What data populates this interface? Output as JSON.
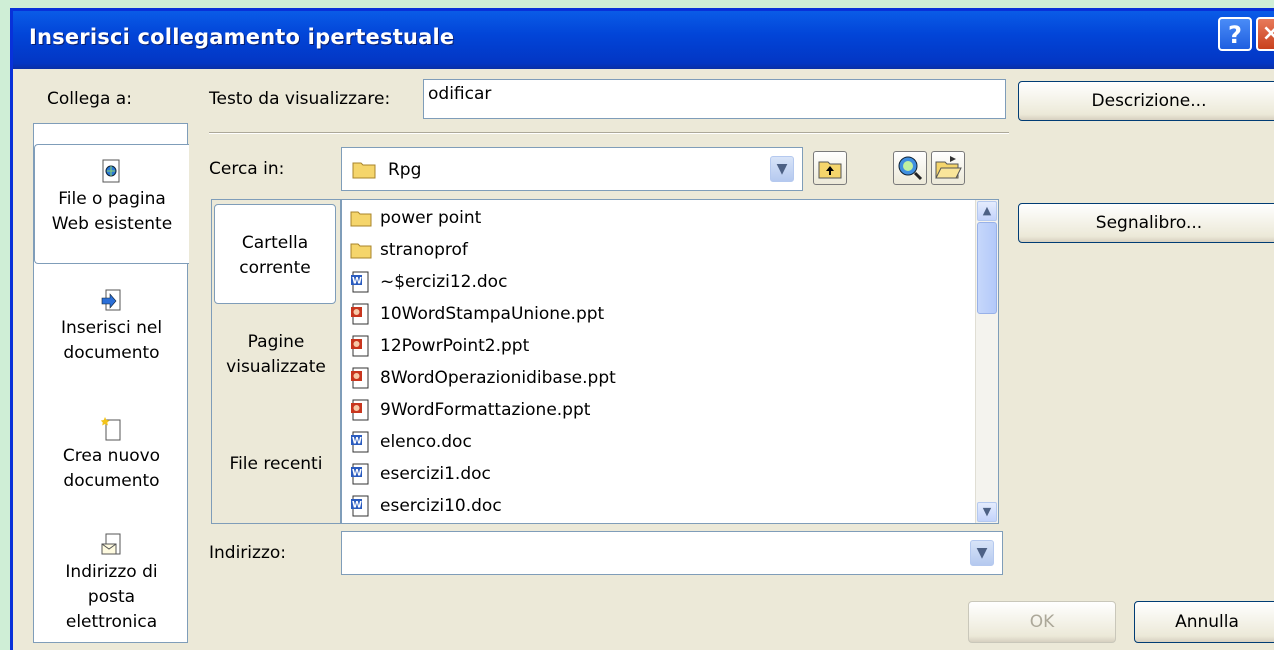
{
  "dialog": {
    "title": "Inserisci collegamento ipertestuale"
  },
  "titlebar": {
    "help": "?",
    "close": "×"
  },
  "link_to": {
    "label": "Collega a:",
    "items": [
      {
        "line1": "File o pagina",
        "line2": "Web esistente"
      },
      {
        "line1": "Inserisci nel",
        "line2": "documento"
      },
      {
        "line1": "Crea nuovo",
        "line2": "documento"
      },
      {
        "line1": "Indirizzo di",
        "line2": "posta",
        "line3": "elettronica"
      }
    ]
  },
  "display_text": {
    "label": "Testo da visualizzare:",
    "value": "odificar"
  },
  "buttons": {
    "screentip": "Descrizione...",
    "bookmark": "Segnalibro...",
    "ok": "OK",
    "cancel": "Annulla"
  },
  "look_in": {
    "label": "Cerca in:",
    "value": "Rpg"
  },
  "view_tabs": [
    {
      "line1": "Cartella",
      "line2": "corrente"
    },
    {
      "line1": "Pagine",
      "line2": "visualizzate"
    },
    {
      "line1": "File recenti"
    }
  ],
  "files": [
    {
      "name": "power point",
      "type": "folder"
    },
    {
      "name": "stranoprof",
      "type": "folder"
    },
    {
      "name": "~$ercizi12.doc",
      "type": "doc"
    },
    {
      "name": "10WordStampaUnione.ppt",
      "type": "ppt"
    },
    {
      "name": "12PowrPoint2.ppt",
      "type": "ppt"
    },
    {
      "name": "8WordOperazionidibase.ppt",
      "type": "ppt"
    },
    {
      "name": "9WordFormattazione.ppt",
      "type": "ppt"
    },
    {
      "name": "elenco.doc",
      "type": "doc"
    },
    {
      "name": "esercizi1.doc",
      "type": "doc"
    },
    {
      "name": "esercizi10.doc",
      "type": "doc"
    }
  ],
  "address": {
    "label": "Indirizzo:",
    "value": ""
  },
  "colors": {
    "titlebar": "#0245d8",
    "dialog_bg": "#ece9d8",
    "outer_bg": "#cfeed6"
  }
}
